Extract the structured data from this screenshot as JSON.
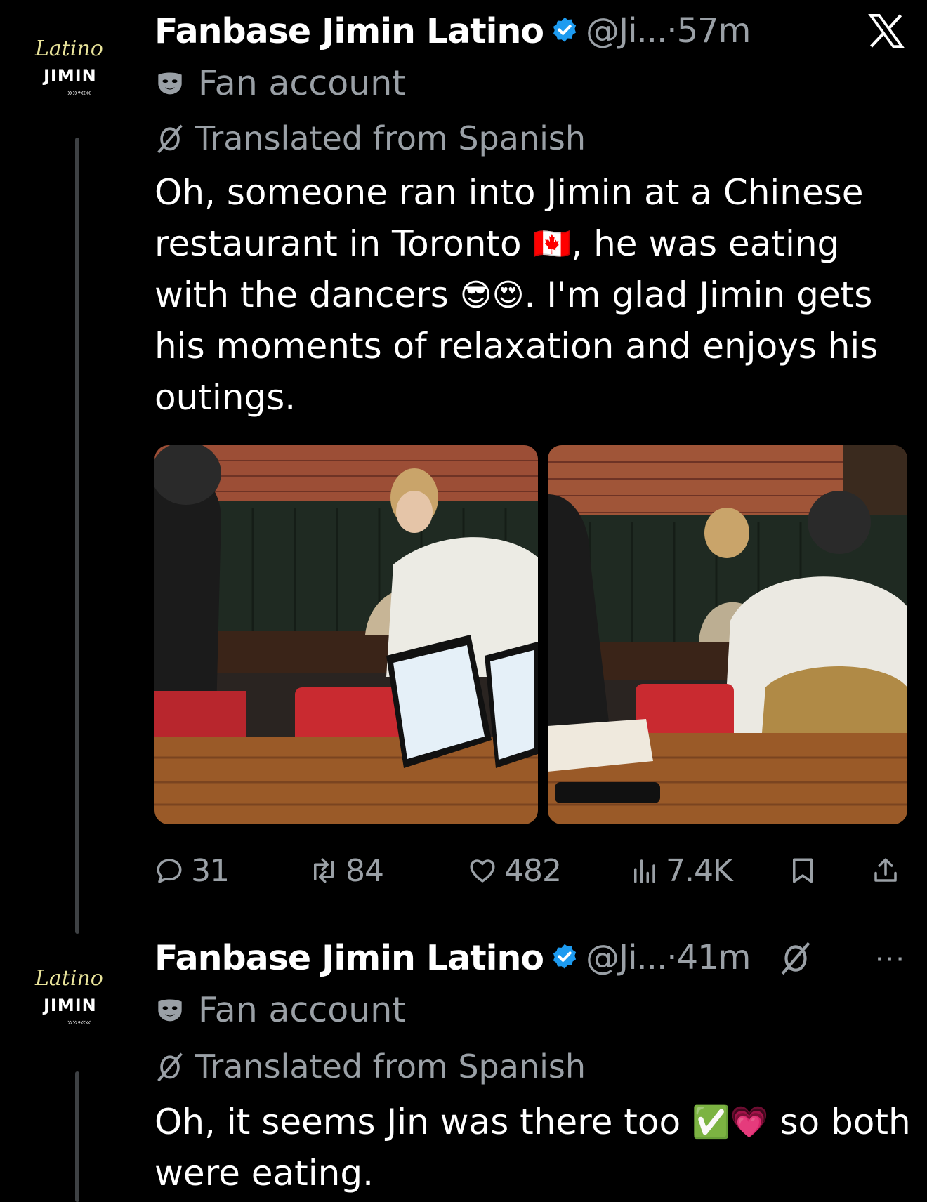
{
  "colors": {
    "background": "#000000",
    "text_primary": "#ffffff",
    "text_secondary": "#9aa0a6",
    "verified_blue": "#1d9bf0",
    "thread_line": "#3e4144"
  },
  "tweets": [
    {
      "avatar": {
        "script": "Latino",
        "brand": "JIMIN",
        "arrows": "»»•««"
      },
      "display_name": "Fanbase Jimin Latino",
      "handle": "@Ji...",
      "separator": "·",
      "time": "57m",
      "fan_label": "Fan account",
      "translated_label": "Translated from Spanish",
      "text_parts": {
        "p1": "Oh, someone ran into Jimin at a Chinese restaurant in Toronto ",
        "e1": "🇨🇦",
        "p2": ", he was eating with the dancers ",
        "e2": "😎",
        "e3": "😍",
        "p3": ". I'm glad Jimin gets his moments of relaxation and enjoys his outings."
      },
      "stats": {
        "replies": "31",
        "reposts": "84",
        "likes": "482",
        "views": "7.4K"
      },
      "icons": [
        "x-logo-icon",
        "reply-icon",
        "repost-icon",
        "like-icon",
        "views-icon",
        "bookmark-icon",
        "share-icon"
      ]
    },
    {
      "avatar": {
        "script": "Latino",
        "brand": "JIMIN",
        "arrows": "»»•««"
      },
      "display_name": "Fanbase Jimin Latino",
      "handle": "@Ji...",
      "separator": "·",
      "time": "41m",
      "fan_label": "Fan account",
      "translated_label": "Translated from Spanish",
      "text_parts": {
        "p1": "Oh, it seems Jin was there too ",
        "e1": "✅",
        "e2": "💗",
        "p2": " so both were eating."
      },
      "more_label": "···",
      "icons": [
        "translate-icon",
        "more-icon"
      ]
    }
  ]
}
